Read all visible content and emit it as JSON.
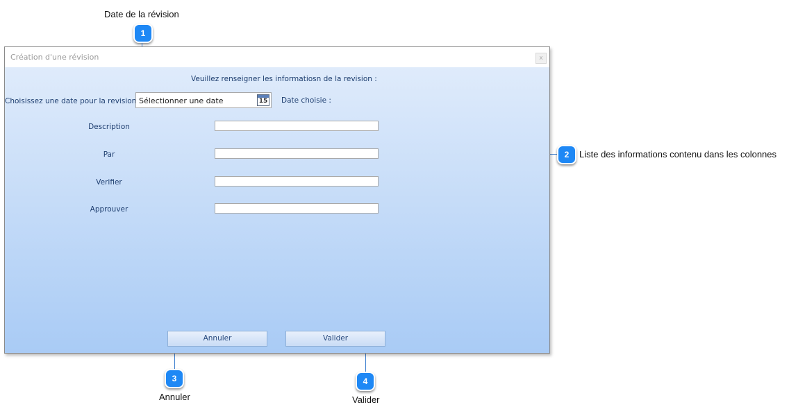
{
  "callouts": [
    {
      "num": "1",
      "text": "Date de la révision"
    },
    {
      "num": "2",
      "text": "Liste des informations contenu dans les colonnes"
    },
    {
      "num": "3",
      "text": "Annuler"
    },
    {
      "num": "4",
      "text": "Valider"
    }
  ],
  "dialog": {
    "title": "Création d'une révision",
    "close_label": "x",
    "instruction": "Veuillez renseigner les informatiosn de la revision :",
    "date_prompt": "Choisissez une date pour la revision :",
    "date_picker": {
      "text": "Sélectionner une date",
      "calendar_day": "15"
    },
    "chosen_date_label": "Date choisie :",
    "fields": [
      {
        "label": "Description",
        "value": ""
      },
      {
        "label": "Par",
        "value": ""
      },
      {
        "label": "Verifier",
        "value": ""
      },
      {
        "label": "Approuver",
        "value": ""
      }
    ],
    "buttons": {
      "cancel": "Annuler",
      "validate": "Valider"
    }
  },
  "colors": {
    "badge": "#1e88f5",
    "gradient_top": "#dfebfb",
    "gradient_bottom": "#a9cbf5",
    "label_text": "#1f3f70"
  }
}
